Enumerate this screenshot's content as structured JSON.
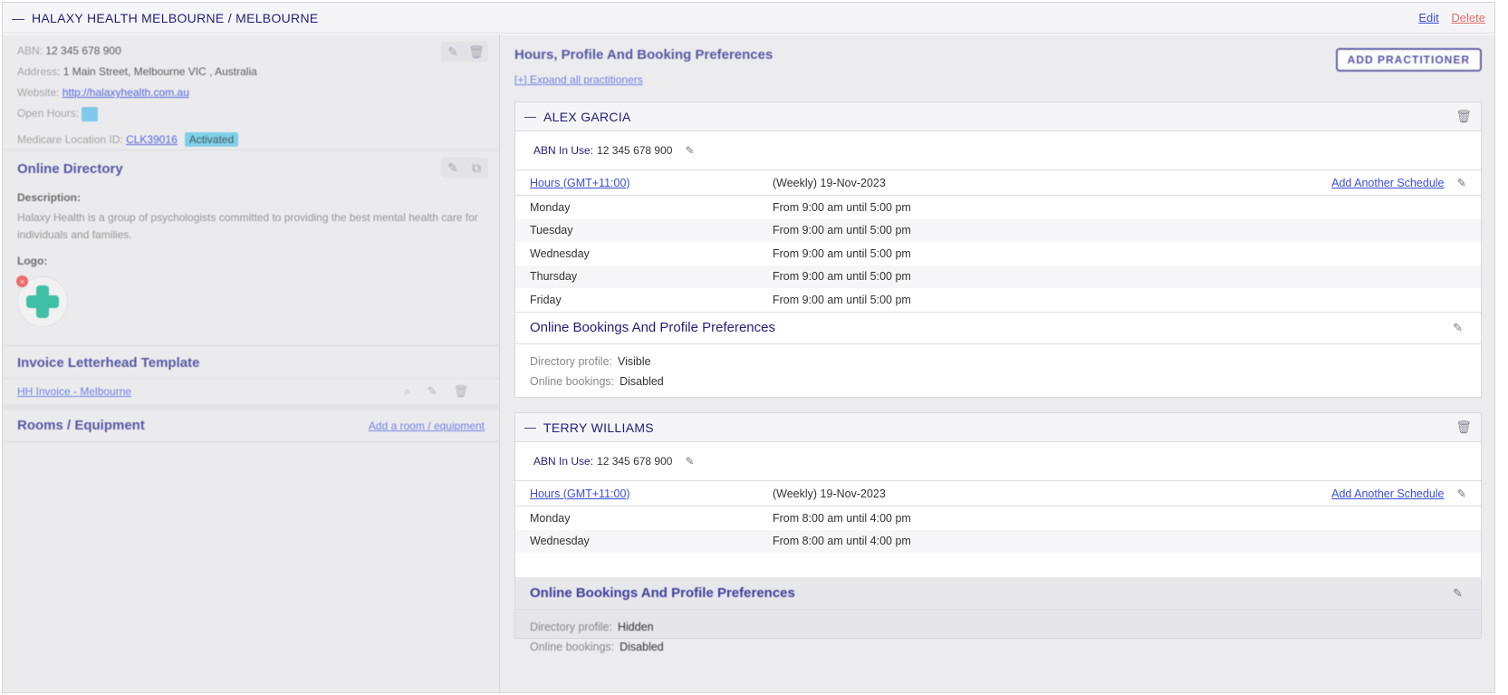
{
  "header": {
    "title": "HALAXY HEALTH MELBOURNE / MELBOURNE",
    "edit": "Edit",
    "delete": "Delete"
  },
  "location": {
    "abn_label": "ABN:",
    "abn": "12 345 678 900",
    "address_label": "Address:",
    "address": "1 Main Street, Melbourne VIC , Australia",
    "website_label": "Website:",
    "website": "http://halaxyhealth.com.au",
    "open_hours_label": "Open Hours:",
    "medicare_label": "Medicare Location ID:",
    "medicare_id": "CLK39016",
    "medicare_status": "Activated"
  },
  "directory": {
    "title": "Online Directory",
    "description_label": "Description:",
    "description": "Halaxy Health is a group of psychologists committed to providing the best mental health care for individuals and families.",
    "logo_label": "Logo:"
  },
  "invoice": {
    "title": "Invoice Letterhead Template",
    "template": "HH Invoice - Melbourne"
  },
  "rooms": {
    "title": "Rooms / Equipment",
    "add_link": "Add a room / equipment"
  },
  "hours": {
    "title": "Hours, Profile And Booking Preferences",
    "expand": "[+] Expand all practitioners",
    "add_practitioner": "ADD PRACTITIONER"
  },
  "practitioners": [
    {
      "name": "ALEX GARCIA",
      "abn_label": "ABN In Use:",
      "abn": "12 345 678 900",
      "hours_tz": "Hours (GMT+11:00)",
      "schedule": "(Weekly) 19-Nov-2023",
      "add_schedule": "Add Another Schedule",
      "days": [
        {
          "day": "Monday",
          "time": "From 9:00 am until 5:00 pm"
        },
        {
          "day": "Tuesday",
          "time": "From 9:00 am until 5:00 pm"
        },
        {
          "day": "Wednesday",
          "time": "From 9:00 am until 5:00 pm"
        },
        {
          "day": "Thursday",
          "time": "From 9:00 am until 5:00 pm"
        },
        {
          "day": "Friday",
          "time": "From 9:00 am until 5:00 pm"
        }
      ],
      "prefs_title": "Online Bookings And Profile Preferences",
      "dir_profile_label": "Directory profile:",
      "dir_profile": "Visible",
      "online_bookings_label": "Online bookings:",
      "online_bookings": "Disabled"
    },
    {
      "name": "TERRY WILLIAMS",
      "abn_label": "ABN In Use:",
      "abn": "12 345 678 900",
      "hours_tz": "Hours (GMT+11:00)",
      "schedule": "(Weekly) 19-Nov-2023",
      "add_schedule": "Add Another Schedule",
      "days": [
        {
          "day": "Monday",
          "time": "From 8:00 am until 4:00 pm"
        },
        {
          "day": "Wednesday",
          "time": "From 8:00 am until 4:00 pm"
        }
      ],
      "prefs_title": "Online Bookings And Profile Preferences",
      "dir_profile_label": "Directory profile:",
      "dir_profile": "Hidden",
      "online_bookings_label": "Online bookings:",
      "online_bookings": "Disabled"
    }
  ],
  "colors": {
    "accent": "#3a4fd8",
    "heading": "#1f1f7a",
    "danger": "#e26d6d",
    "badge": "#6fcbe8"
  }
}
